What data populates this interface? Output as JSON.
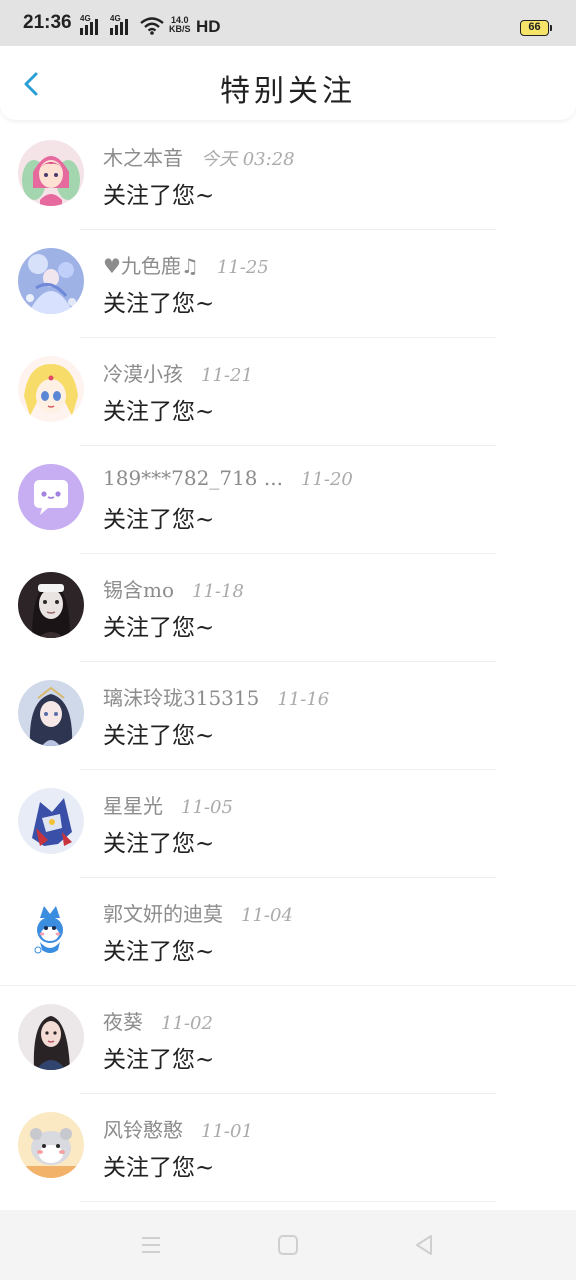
{
  "status_bar": {
    "time": "21:36",
    "signal_1_label": "4G",
    "signal_2_label": "4G",
    "net_speed_value": "14.0",
    "net_speed_unit": "KB/S",
    "hd_label": "HD",
    "battery": "66",
    "icons": [
      "signal-icon",
      "wifi-icon",
      "battery-icon"
    ]
  },
  "header": {
    "title": "特别关注",
    "back_icon": "chevron-left-icon",
    "accent_color": "#2a9fd6"
  },
  "list": {
    "items": [
      {
        "name": "木之本音",
        "date": "今天 03:28",
        "message": "关注了您~"
      },
      {
        "name": "♥九色鹿♫",
        "date": "11-25",
        "message": "关注了您~"
      },
      {
        "name": "冷漠小孩",
        "date": "11-21",
        "message": "关注了您~"
      },
      {
        "name": "189***782_718 ...",
        "date": "11-20",
        "message": "关注了您~"
      },
      {
        "name": "锡含mo",
        "date": "11-18",
        "message": "关注了您~"
      },
      {
        "name": "璃沫玲珑315315",
        "date": "11-16",
        "message": "关注了您~"
      },
      {
        "name": "星星光",
        "date": "11-05",
        "message": "关注了您~"
      },
      {
        "name": "郭文妍的迪莫",
        "date": "11-04",
        "message": "关注了您~"
      },
      {
        "name": "夜葵",
        "date": "11-02",
        "message": "关注了您~"
      },
      {
        "name": "风铃憨憨",
        "date": "11-01",
        "message": "关注了您~"
      }
    ]
  },
  "nav_bar": {
    "icons": [
      "menu-icon",
      "home-square-icon",
      "back-triangle-icon"
    ]
  }
}
